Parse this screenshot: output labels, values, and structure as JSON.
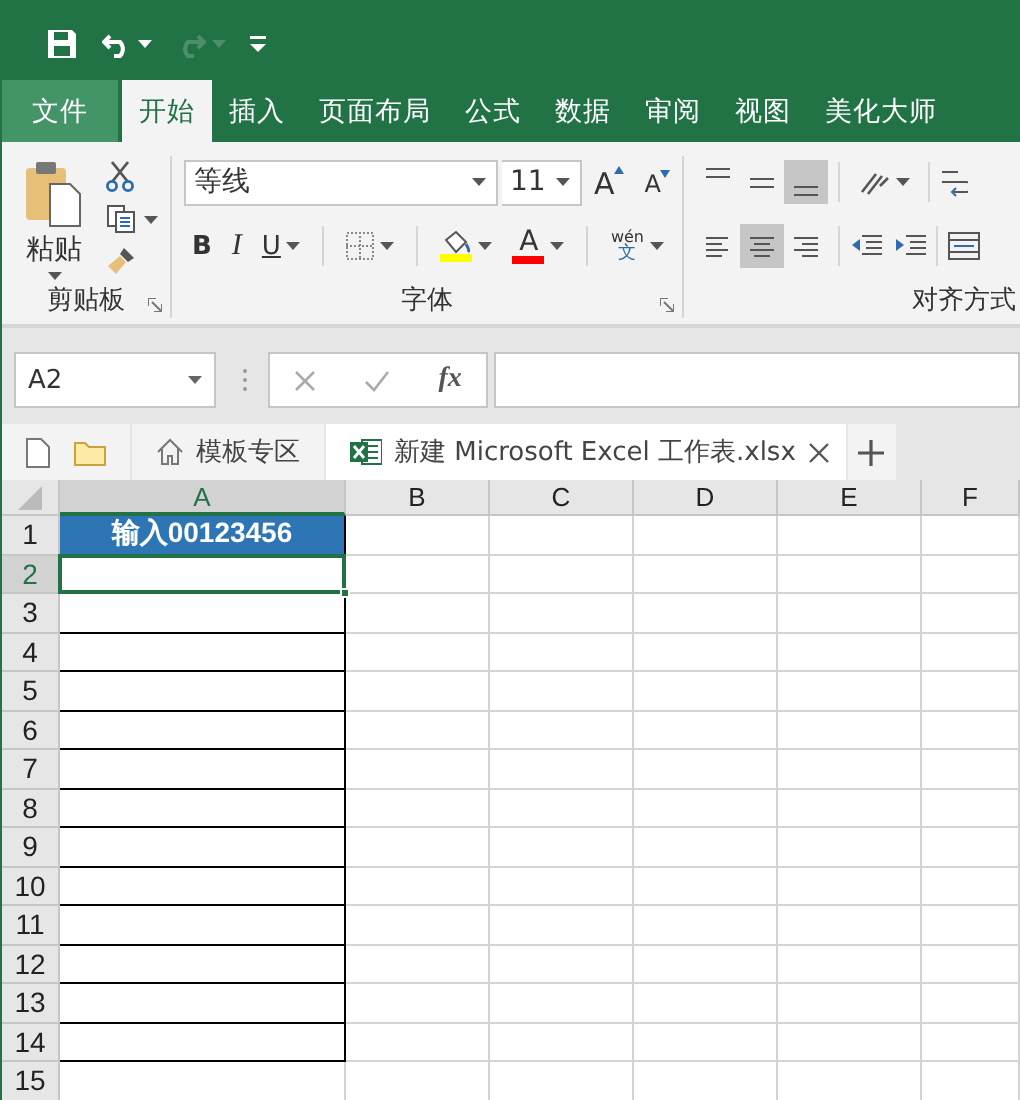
{
  "quick_access": {
    "redo": {
      "disabled": true
    }
  },
  "ribbon_tabs": [
    {
      "label": "文件",
      "kind": "file",
      "selected": false
    },
    {
      "label": "开始",
      "kind": "tab",
      "selected": true
    },
    {
      "label": "插入",
      "kind": "tab",
      "selected": false
    },
    {
      "label": "页面布局",
      "kind": "tab",
      "selected": false
    },
    {
      "label": "公式",
      "kind": "tab",
      "selected": false
    },
    {
      "label": "数据",
      "kind": "tab",
      "selected": false
    },
    {
      "label": "审阅",
      "kind": "tab",
      "selected": false
    },
    {
      "label": "视图",
      "kind": "tab",
      "selected": false
    },
    {
      "label": "美化大师",
      "kind": "tab",
      "selected": false
    }
  ],
  "clipboard": {
    "paste_label": "粘贴",
    "group_label": "剪贴板"
  },
  "font": {
    "font_name": "等线",
    "font_size": "11",
    "grow_label": "A",
    "shrink_label": "A",
    "bold_label": "B",
    "italic_label": "I",
    "underline_label": "U",
    "fill_color": {
      "color": "#ffff00"
    },
    "font_color": {
      "label": "A",
      "color": "#ff0000"
    },
    "phonetic": {
      "top": "wén",
      "bottom": "文"
    },
    "group_label": "字体"
  },
  "alignment": {
    "vertical_align": [
      {
        "selected": false
      },
      {
        "selected": false
      },
      {
        "selected": true
      }
    ],
    "horizontal_align": [
      {
        "selected": false
      },
      {
        "selected": true
      },
      {
        "selected": false
      }
    ],
    "group_label": "对齐方式"
  },
  "formula_bar": {
    "name_box": "A2",
    "function_label": "fx"
  },
  "doc_tabs": [
    {
      "label": "模板专区",
      "kind": "home",
      "selected": false
    },
    {
      "label": "新建 Microsoft Excel 工作表.xlsx",
      "kind": "workbook",
      "selected": true
    }
  ],
  "sheet": {
    "columns": [
      {
        "label": "A",
        "selected": true
      },
      {
        "label": "B",
        "selected": false
      },
      {
        "label": "C",
        "selected": false
      },
      {
        "label": "D",
        "selected": false
      },
      {
        "label": "E",
        "selected": false
      },
      {
        "label": "F",
        "selected": false
      }
    ],
    "rows": [
      {
        "label": "1",
        "selected": false,
        "bordered": true,
        "cell": {
          "value": "输入00123456",
          "color": "#2e75b6"
        }
      },
      {
        "label": "2",
        "selected": true,
        "bordered": true
      },
      {
        "label": "3",
        "selected": false,
        "bordered": true
      },
      {
        "label": "4",
        "selected": false,
        "bordered": true
      },
      {
        "label": "5",
        "selected": false,
        "bordered": true
      },
      {
        "label": "6",
        "selected": false,
        "bordered": true
      },
      {
        "label": "7",
        "selected": false,
        "bordered": true
      },
      {
        "label": "8",
        "selected": false,
        "bordered": true
      },
      {
        "label": "9",
        "selected": false,
        "bordered": true
      },
      {
        "label": "10",
        "selected": false,
        "bordered": true
      },
      {
        "label": "11",
        "selected": false,
        "bordered": true
      },
      {
        "label": "12",
        "selected": false,
        "bordered": true
      },
      {
        "label": "13",
        "selected": false,
        "bordered": true
      },
      {
        "label": "14",
        "selected": false,
        "bordered": true
      },
      {
        "label": "15",
        "selected": false,
        "bordered": false
      }
    ]
  }
}
